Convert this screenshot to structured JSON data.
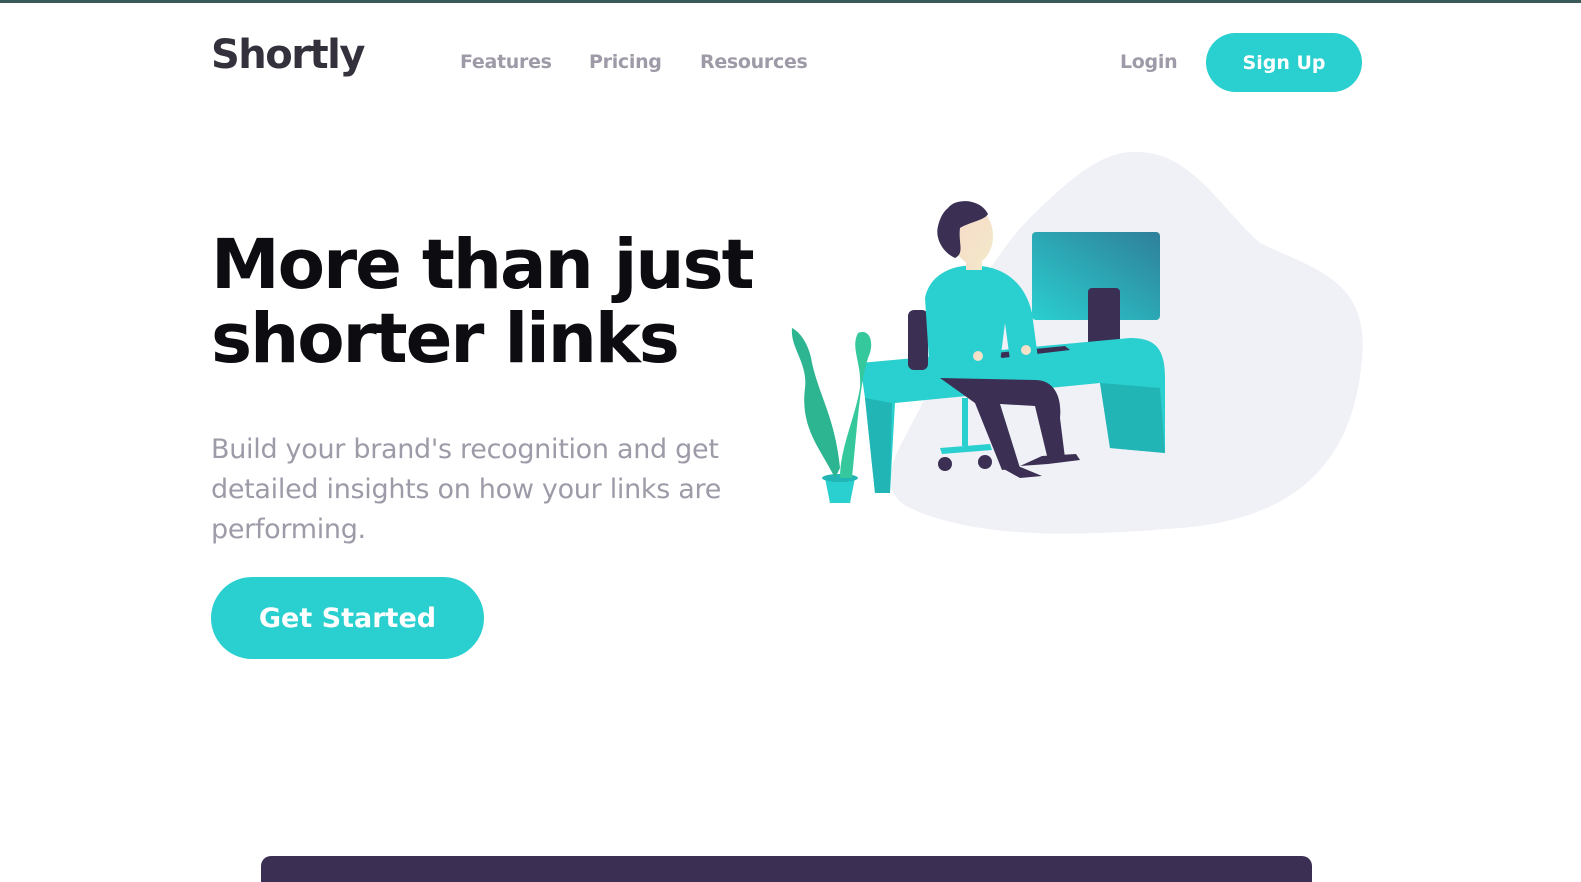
{
  "header": {
    "logo": "Shortly",
    "nav": {
      "features": "Features",
      "pricing": "Pricing",
      "resources": "Resources"
    },
    "login": "Login",
    "signup": "Sign Up"
  },
  "hero": {
    "title": "More than just shorter links",
    "subtitle": "Build your brand's recognition and get detailed insights on how your links are performing.",
    "cta": "Get Started"
  },
  "colors": {
    "accent": "#2acfcf",
    "dark_violet": "#3b3054",
    "heading": "#0d0c11",
    "muted": "#9e9aa7",
    "logo": "#34313d",
    "blob": "#eff1f7"
  },
  "illustration": {
    "icon": "person-working-at-desk-illustration"
  }
}
